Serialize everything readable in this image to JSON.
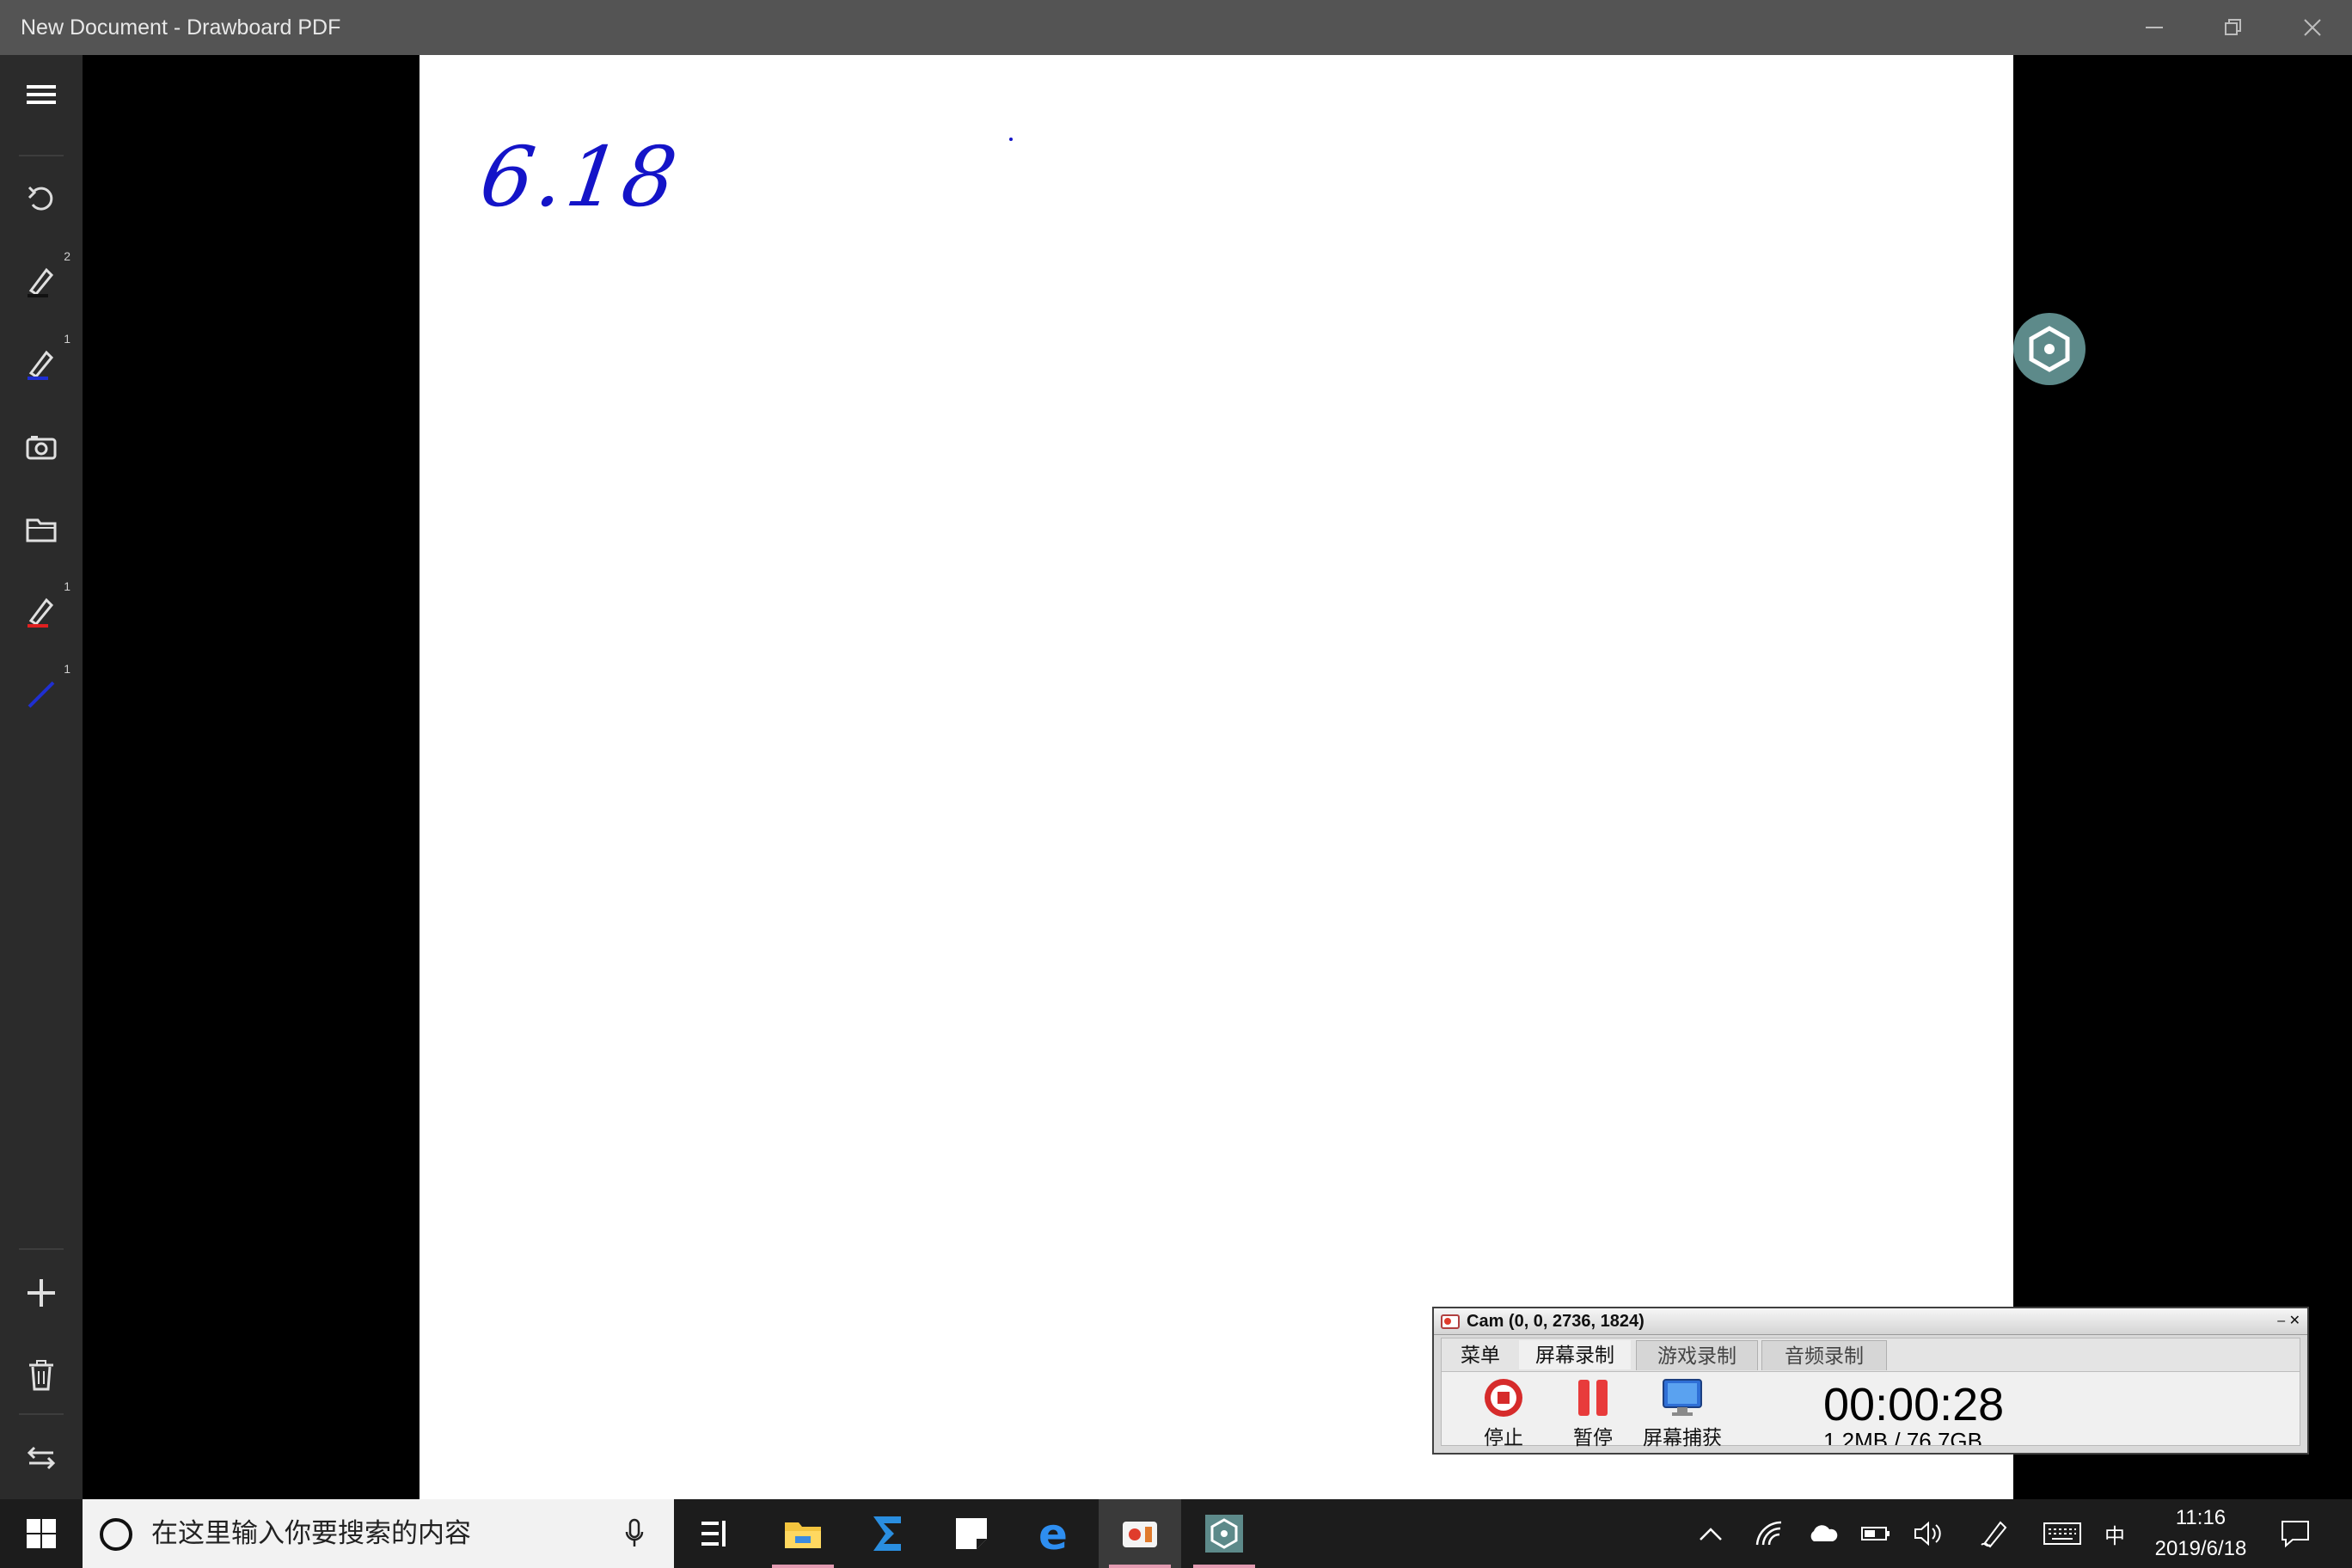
{
  "window": {
    "title": "New Document - Drawboard PDF",
    "minimize": "–",
    "restore": "❐",
    "close": "✕"
  },
  "sidebar": {
    "badges": {
      "pen1": "2",
      "pen2": "1",
      "highlighter": "1",
      "line": "1"
    },
    "icons": [
      "menu-icon",
      "undo-icon",
      "pen-icon",
      "pen-icon",
      "camera-icon",
      "folder-icon",
      "highlighter-icon",
      "line-icon",
      "add-icon",
      "delete-icon",
      "swap-icon"
    ]
  },
  "canvas": {
    "handwritten_text": "6.18",
    "ink_color": "#1414c8"
  },
  "ocam": {
    "title": "Cam (0, 0, 2736, 1824)",
    "tabs": [
      "菜单",
      "屏幕录制",
      "游戏录制",
      "音频录制"
    ],
    "active_tab": "屏幕录制",
    "buttons": {
      "stop": "停止",
      "pause": "暂停",
      "capture": "屏幕捕获"
    },
    "timer": "00:00:28",
    "size_info": "1.2MB / 76.7GB"
  },
  "taskbar": {
    "search_placeholder": "在这里输入你要搜索的内容",
    "ime": "中",
    "time": "11:16",
    "date": "2019/6/18"
  },
  "colors": {
    "titlebar": "#545454",
    "sidebar": "#2b2b2b",
    "canvas": "#ffffff",
    "fab": "#5d8a8a",
    "taskbar": "#1c1c1c"
  }
}
